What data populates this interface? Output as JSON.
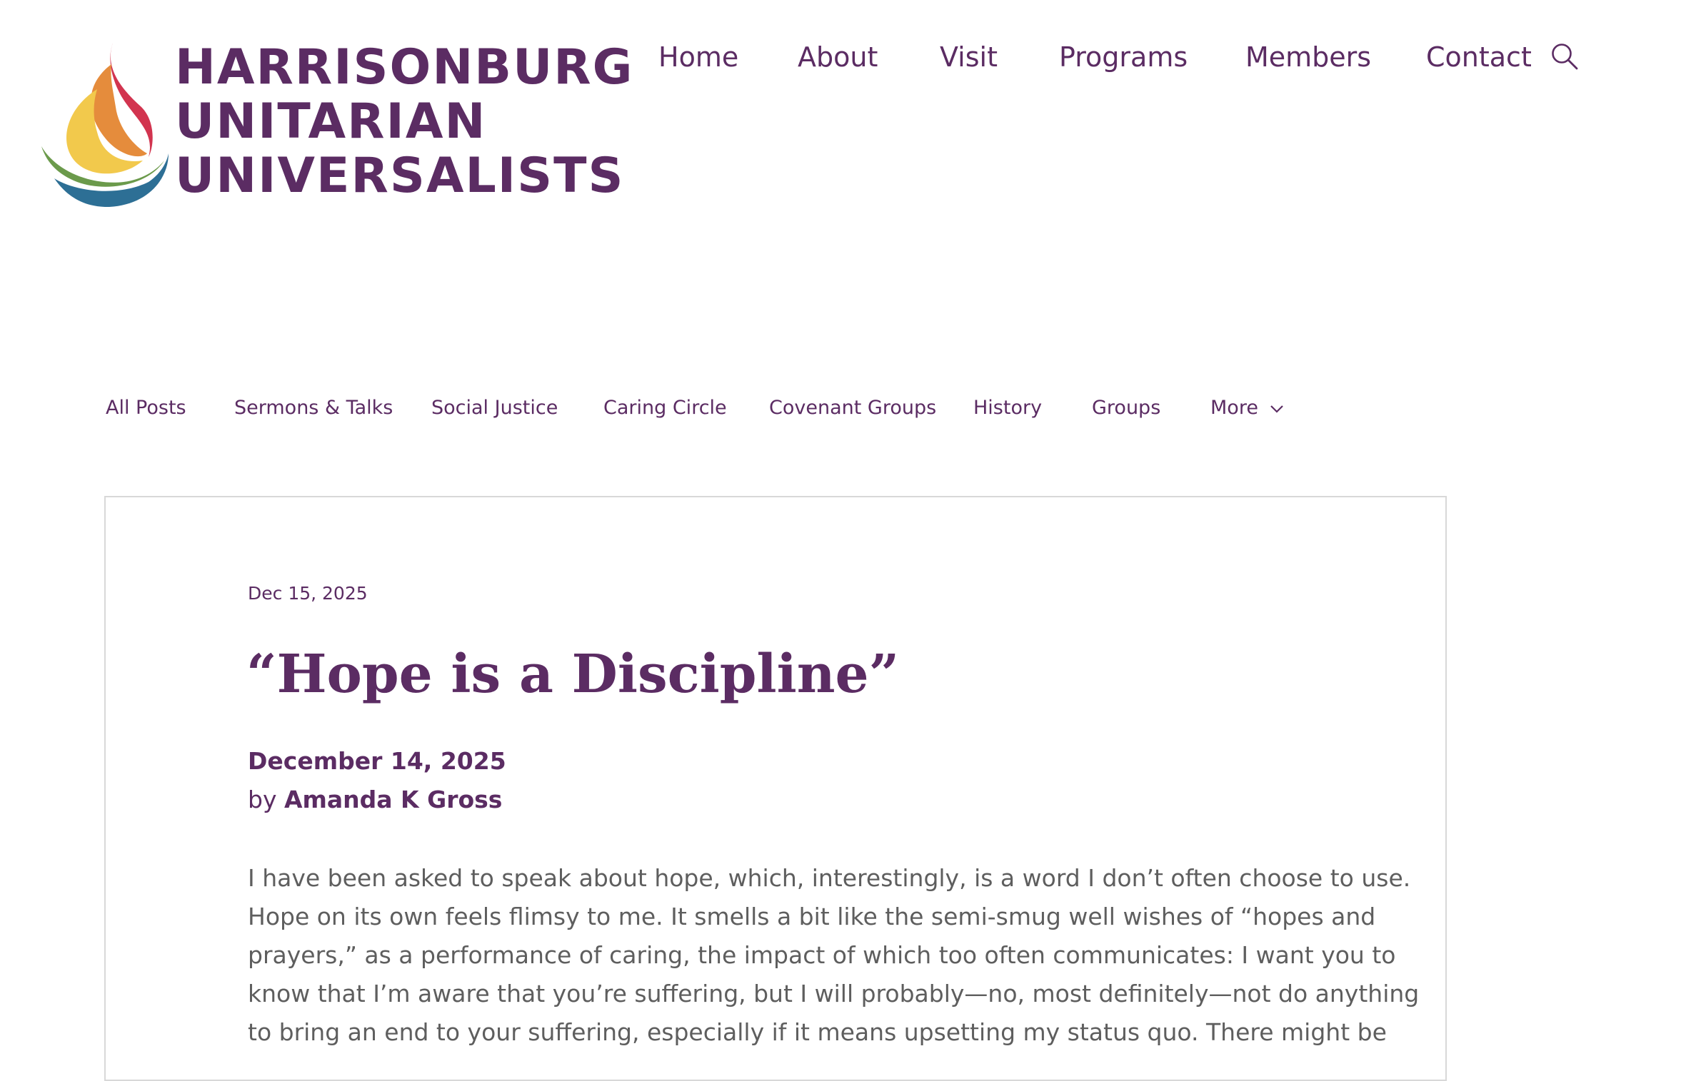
{
  "site": {
    "logo_lines": [
      "HARRISONBURG",
      "UNITARIAN",
      "UNIVERSALISTS"
    ],
    "brand_color": "#5b2c63",
    "logo_colors": [
      "#d2344f",
      "#e58c3c",
      "#f2c94c",
      "#6b9a4b",
      "#2d6f95"
    ]
  },
  "main_nav": {
    "items": [
      "Home",
      "About",
      "Visit",
      "Programs",
      "Members",
      "Contact"
    ],
    "search_icon": "search-icon"
  },
  "category_nav": {
    "items": [
      "All Posts",
      "Sermons & Talks",
      "Social Justice",
      "Caring Circle",
      "Covenant Groups",
      "History",
      "Groups",
      "More"
    ],
    "more_icon": "chevron-down-icon"
  },
  "post": {
    "date": "Dec 15, 2025",
    "title": "“Hope is a Discipline”",
    "sermon_date": "December 14, 2025",
    "by": "by",
    "author": "Amanda K Gross",
    "body_lines": [
      "I have been asked to speak about hope, which, interestingly, is a word I don’t often choose to use.",
      "Hope on its own feels flimsy to me. It smells a bit like the semi-smug well wishes of “hopes and",
      "prayers,” as a performance of caring, the impact of which too often communicates: I want you to",
      "know that I’m aware that you’re suffering, but I will probably—no, most definitely—not do anything",
      "to bring an end to your suffering, especially if it means upsetting my status quo. There might be"
    ]
  }
}
